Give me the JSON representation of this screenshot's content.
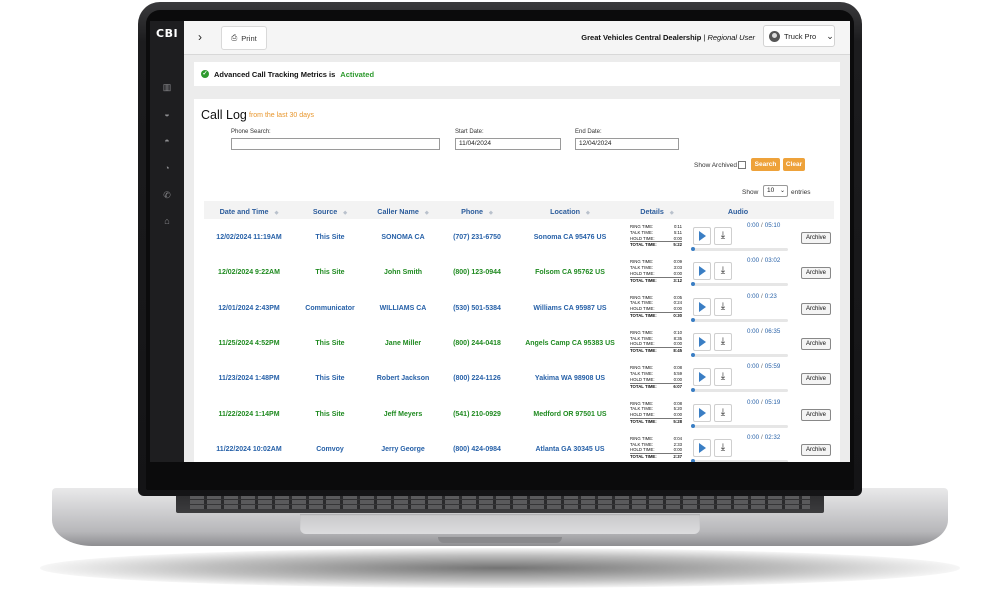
{
  "app": {
    "logo": "CBI"
  },
  "toolbar": {
    "print_label": "Print"
  },
  "header": {
    "dealership": "Great Vehicles Central Dealership",
    "separator": " | ",
    "role": "Regional User",
    "user": "Truck Pro"
  },
  "notice": {
    "text": "Advanced Call Tracking Metrics is",
    "status": "Activated"
  },
  "calllog": {
    "title": "Call Log",
    "subtitle": "from the last 30 days",
    "phone_label": "Phone Search:",
    "phone_value": "",
    "start_label": "Start Date:",
    "start_value": "11/04/2024",
    "end_label": "End Date:",
    "end_value": "12/04/2024",
    "archived_label": "Show Archived",
    "search_label": "Search",
    "clear_label": "Clear",
    "show_label": "Show",
    "page_size": "10",
    "entries_label": "entries"
  },
  "columns": [
    "Date and Time",
    "Source",
    "Caller Name",
    "Phone",
    "Location",
    "Details",
    "Audio"
  ],
  "detail_labels": {
    "ring": "RING TIME:",
    "talk": "TALK TIME:",
    "hold": "HOLD TIME:",
    "total": "TOTAL TIME:"
  },
  "archive_label": "Archive",
  "audio_sep": "/",
  "rows": [
    {
      "datetime": "12/02/2024 11:19AM",
      "source": "This Site",
      "caller": "SONOMA CA",
      "phone": "(707) 231-6750",
      "location": "Sonoma CA 95476 US",
      "ring": "0:11",
      "talk": "5:11",
      "hold": "0:00",
      "total": "5:22",
      "audio_current": "0:00",
      "audio_duration": "05:10",
      "color": "blue"
    },
    {
      "datetime": "12/02/2024 9:22AM",
      "source": "This Site",
      "caller": "John Smith",
      "phone": "(800) 123-0944",
      "location": "Folsom CA 95762 US",
      "ring": "0:09",
      "talk": "3:03",
      "hold": "0:00",
      "total": "3:12",
      "audio_current": "0:00",
      "audio_duration": "03:02",
      "color": "green"
    },
    {
      "datetime": "12/01/2024 2:43PM",
      "source": "Communicator",
      "caller": "WILLIAMS CA",
      "phone": "(530) 501-5384",
      "location": "Williams CA 95987 US",
      "ring": "0:05",
      "talk": "0:24",
      "hold": "0:00",
      "total": "0:30",
      "audio_current": "0:00",
      "audio_duration": "0:23",
      "color": "blue"
    },
    {
      "datetime": "11/25/2024 4:52PM",
      "source": "This Site",
      "caller": "Jane Miller",
      "phone": "(800) 244-0418",
      "location": "Angels Camp CA 95383 US",
      "ring": "0:10",
      "talk": "8:35",
      "hold": "0:00",
      "total": "8:45",
      "audio_current": "0:00",
      "audio_duration": "06:35",
      "color": "green"
    },
    {
      "datetime": "11/23/2024 1:48PM",
      "source": "This Site",
      "caller": "Robert Jackson",
      "phone": "(800) 224-1126",
      "location": "Yakima WA 98908 US",
      "ring": "0:08",
      "talk": "5:59",
      "hold": "0:00",
      "total": "6:07",
      "audio_current": "0:00",
      "audio_duration": "05:59",
      "color": "blue"
    },
    {
      "datetime": "11/22/2024 1:14PM",
      "source": "This Site",
      "caller": "Jeff Meyers",
      "phone": "(541) 210-0929",
      "location": "Medford OR 97501 US",
      "ring": "0:08",
      "talk": "5:20",
      "hold": "0:00",
      "total": "5:28",
      "audio_current": "0:00",
      "audio_duration": "05:19",
      "color": "green"
    },
    {
      "datetime": "11/22/2024 10:02AM",
      "source": "Comvoy",
      "caller": "Jerry George",
      "phone": "(800) 424-0984",
      "location": "Atlanta GA 30345 US",
      "ring": "0:04",
      "talk": "2:33",
      "hold": "0:00",
      "total": "2:37",
      "audio_current": "0:00",
      "audio_duration": "02:32",
      "color": "blue"
    }
  ]
}
